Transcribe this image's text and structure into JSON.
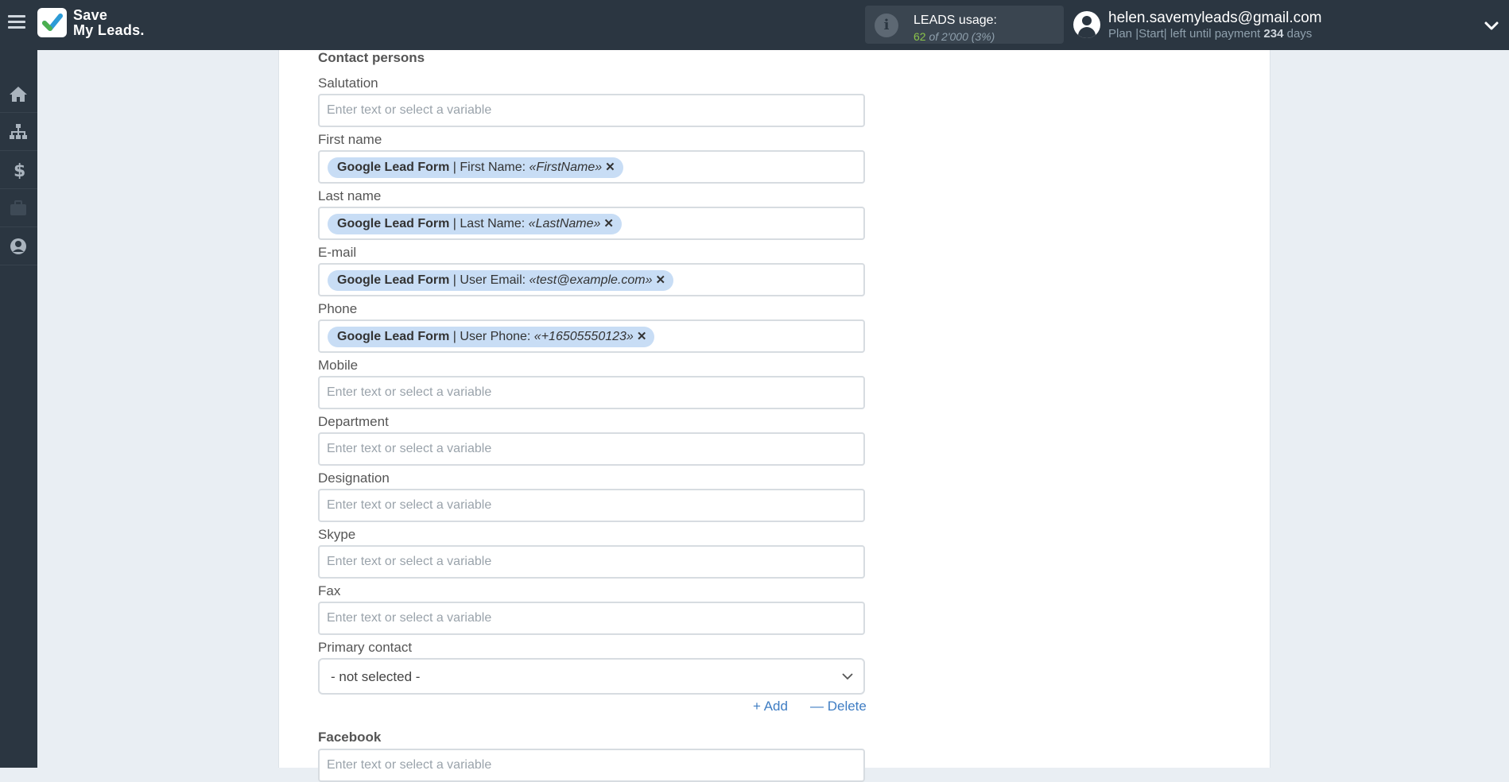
{
  "header": {
    "logo_line1": "Save",
    "logo_line2": "My Leads.",
    "usage_title": "LEADS usage:",
    "usage_used": "62",
    "usage_of": "of 2'000",
    "usage_pct": "(3%)",
    "user_email": "helen.savemyleads@gmail.com",
    "plan_prefix": "Plan |Start| left until payment",
    "plan_days": "234",
    "plan_suffix": "days"
  },
  "sidebar": {
    "items": [
      {
        "name": "home-icon"
      },
      {
        "name": "sitemap-icon"
      },
      {
        "name": "dollar-icon"
      },
      {
        "name": "briefcase-icon"
      },
      {
        "name": "user-icon"
      }
    ]
  },
  "form": {
    "section_title": "Contact persons",
    "placeholder": "Enter text or select a variable",
    "fields": {
      "salutation": "Salutation",
      "first_name": "First name",
      "last_name": "Last name",
      "email": "E-mail",
      "phone": "Phone",
      "mobile": "Mobile",
      "department": "Department",
      "designation": "Designation",
      "skype": "Skype",
      "fax": "Fax",
      "primary_contact": "Primary contact",
      "facebook": "Facebook"
    },
    "tags": {
      "first_name": {
        "source": "Google Lead Form",
        "label": "| First Name:",
        "value": "«FirstName»"
      },
      "last_name": {
        "source": "Google Lead Form",
        "label": "| Last Name:",
        "value": "«LastName»"
      },
      "email": {
        "source": "Google Lead Form",
        "label": "| User Email:",
        "value": "«test@example.com»"
      },
      "phone": {
        "source": "Google Lead Form",
        "label": "| User Phone:",
        "value": "«+16505550123»"
      }
    },
    "primary_contact_value": "- not selected -",
    "add_label": "+ Add",
    "delete_label": "— Delete"
  },
  "colors": {
    "topbar": "#2b3641",
    "tag": "#c8ddf5",
    "link": "#3f7dc3",
    "usage_green": "#8bc34a"
  }
}
